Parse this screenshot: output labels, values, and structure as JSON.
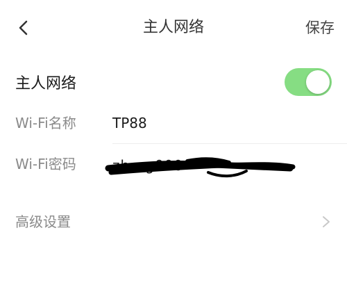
{
  "header": {
    "title": "主人网络",
    "save_label": "保存"
  },
  "main": {
    "label": "主人网络",
    "toggle_on": true
  },
  "wifi_name": {
    "label": "Wi-Fi名称",
    "value": "TP88"
  },
  "wifi_password": {
    "label": "Wi-Fi密码",
    "value": "zh···g000·"
  },
  "advanced": {
    "label": "高级设置"
  },
  "colors": {
    "toggle_on": "#86dd83",
    "label_gray": "#8a8a8a"
  }
}
